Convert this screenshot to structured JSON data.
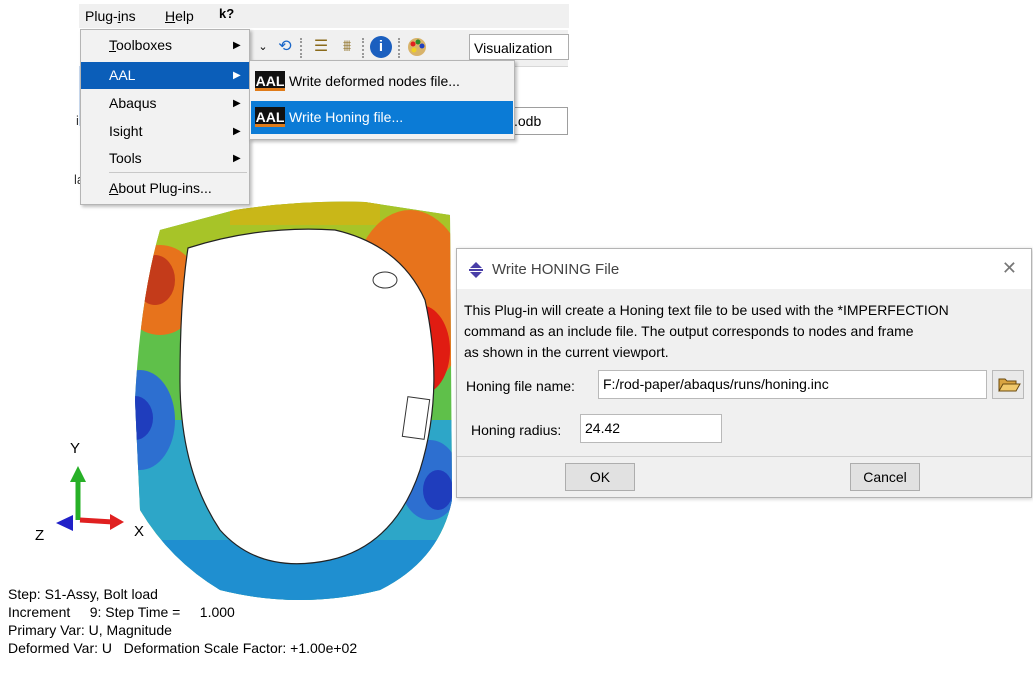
{
  "menubar": {
    "plugins": "Plug-ins",
    "help": "Help",
    "whats_this": "k?"
  },
  "toolbar": {
    "module_combo": "Visualization"
  },
  "background_fragments": {
    "field_suffix": ".odb",
    "frag_i": "i:",
    "frag_l": "la"
  },
  "plugins_menu": {
    "items": [
      {
        "label": "Toolboxes",
        "has_submenu": true,
        "active": false
      },
      {
        "label": "AAL",
        "has_submenu": true,
        "active": true
      },
      {
        "label": "Abaqus",
        "has_submenu": true,
        "active": false
      },
      {
        "label": "Isight",
        "has_submenu": true,
        "active": false
      },
      {
        "label": "Tools",
        "has_submenu": true,
        "active": false
      },
      {
        "label": "About Plug-ins...",
        "has_submenu": false,
        "active": false
      }
    ]
  },
  "aal_submenu": {
    "logo_text": "AAL",
    "items": [
      {
        "label": "Write deformed nodes file...",
        "active": false
      },
      {
        "label": "Write Honing file...",
        "active": true
      }
    ]
  },
  "viewport": {
    "triad": {
      "y": "Y",
      "x": "X",
      "z": "Z"
    },
    "legend": {
      "step": "Step: S1-Assy, Bolt load",
      "increment": "Increment     9: Step Time =     1.000",
      "primary_var": "Primary Var: U, Magnitude",
      "deformed_var": "Deformed Var: U   Deformation Scale Factor: +1.00e+02"
    }
  },
  "dialog": {
    "title": "Write HONING File",
    "close_glyph": "✕",
    "description_lines": [
      "This Plug-in will create a Honing text file to be used with the *IMPERFECTION",
      "command as an include file. The output corresponds to nodes and frame",
      "as shown in the current viewport."
    ],
    "file_label": "Honing file name:",
    "file_value": "F:/rod-paper/abaqus/runs/honing.inc",
    "radius_label": "Honing radius:",
    "radius_value": "24.42",
    "ok_label": "OK",
    "cancel_label": "Cancel"
  },
  "colors": {
    "menu_active": "#0b5eb9",
    "submenu_active": "#0b7bd6",
    "aal_accent": "#e07b19"
  }
}
